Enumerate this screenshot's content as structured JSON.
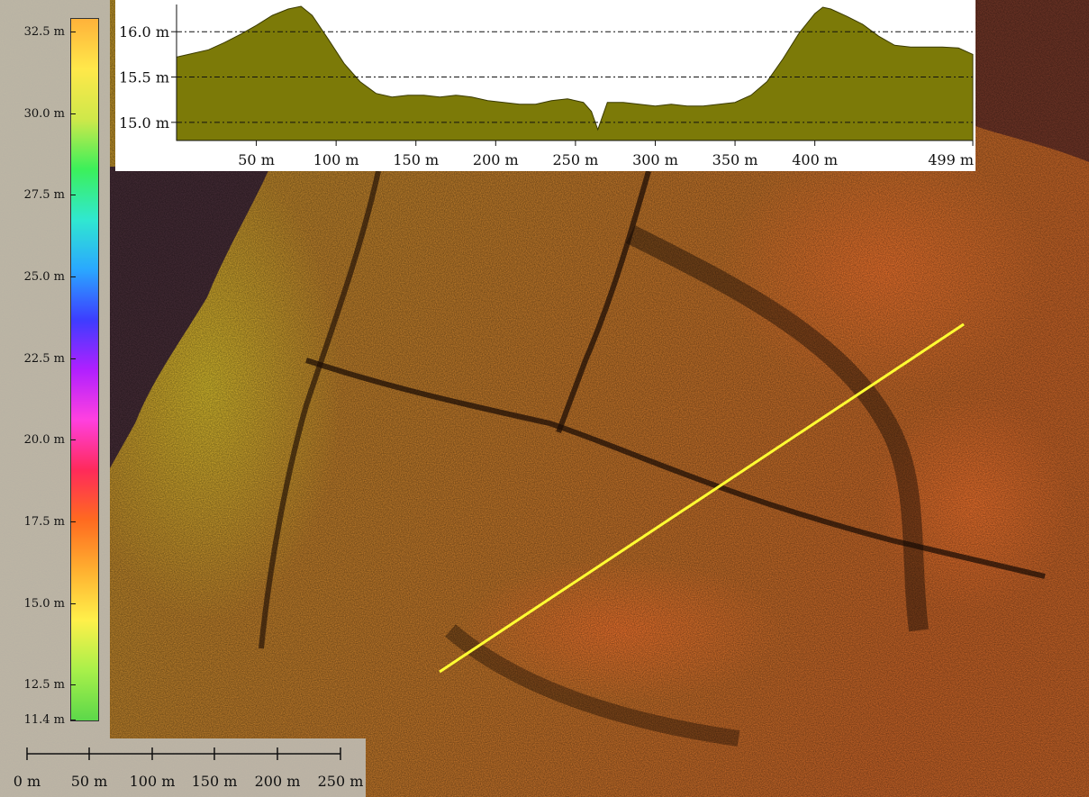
{
  "legend": {
    "ticks": [
      "32.5 m",
      "30.0 m",
      "27.5 m",
      "25.0 m",
      "22.5 m",
      "20.0 m",
      "17.5 m",
      "15.0 m",
      "12.5 m",
      "11.4 m"
    ],
    "colors": [
      "#ffb23a",
      "#ffe84a",
      "#cfe84a",
      "#3cf05a",
      "#30e8d0",
      "#2aa8ff",
      "#3d3dff",
      "#b020ff",
      "#ff40e0",
      "#ff2a5a",
      "#ff6a20",
      "#ffb030",
      "#fff04a",
      "#a8f04a",
      "#5cd84a"
    ]
  },
  "scale_bar": {
    "labels": [
      "0 m",
      "50 m",
      "100 m",
      "150 m",
      "200 m",
      "250 m"
    ]
  },
  "profile": {
    "fill_color": "#7c7a08",
    "y_ticks": [
      {
        "label": "16.0 m",
        "value": 16.0
      },
      {
        "label": "15.5 m",
        "value": 15.5
      },
      {
        "label": "15.0 m",
        "value": 15.0
      }
    ],
    "x_ticks": [
      {
        "label": "50 m",
        "value": 50
      },
      {
        "label": "100 m",
        "value": 100
      },
      {
        "label": "150 m",
        "value": 150
      },
      {
        "label": "200 m",
        "value": 200
      },
      {
        "label": "250 m",
        "value": 250
      },
      {
        "label": "300 m",
        "value": 300
      },
      {
        "label": "350 m",
        "value": 350
      },
      {
        "label": "400 m",
        "value": 400
      },
      {
        "label": "499 m",
        "value": 499
      }
    ]
  },
  "chart_data": {
    "type": "area",
    "xlabel": "",
    "ylabel": "",
    "xlim": [
      0,
      499
    ],
    "ylim": [
      14.8,
      16.3
    ],
    "x": [
      0,
      10,
      20,
      30,
      40,
      50,
      60,
      70,
      78,
      85,
      95,
      105,
      115,
      125,
      135,
      145,
      155,
      165,
      175,
      185,
      195,
      205,
      215,
      225,
      235,
      245,
      255,
      260,
      264,
      270,
      280,
      290,
      300,
      310,
      320,
      330,
      340,
      350,
      360,
      370,
      380,
      390,
      400,
      405,
      410,
      420,
      430,
      440,
      450,
      460,
      470,
      480,
      490,
      499
    ],
    "y": [
      15.72,
      15.76,
      15.8,
      15.88,
      15.97,
      16.07,
      16.18,
      16.25,
      16.28,
      16.18,
      15.92,
      15.65,
      15.45,
      15.32,
      15.28,
      15.3,
      15.3,
      15.28,
      15.3,
      15.28,
      15.24,
      15.22,
      15.2,
      15.2,
      15.24,
      15.26,
      15.22,
      15.12,
      14.92,
      15.22,
      15.22,
      15.2,
      15.18,
      15.2,
      15.18,
      15.18,
      15.2,
      15.22,
      15.3,
      15.45,
      15.7,
      15.98,
      16.2,
      16.27,
      16.25,
      16.17,
      16.08,
      15.95,
      15.85,
      15.83,
      15.83,
      15.83,
      15.82,
      15.75
    ]
  },
  "map": {
    "transect_color": "#ffff33"
  }
}
